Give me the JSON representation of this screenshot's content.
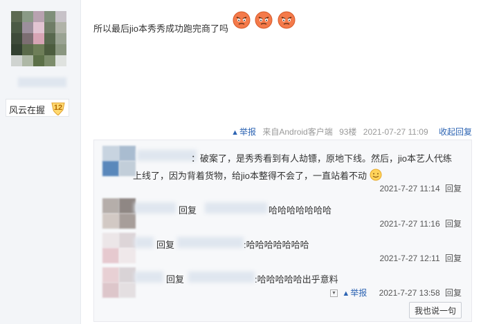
{
  "user": {
    "badge_name": "风云在握",
    "badge_level": "12"
  },
  "post": {
    "text": "所以最后jio本秀秀成功跑完商了吗",
    "emojis": [
      "angry-face-icon",
      "angry-face-icon",
      "angry-face-icon"
    ]
  },
  "tail": {
    "report_label": "举报",
    "source": "来自Android客户端",
    "floor": "93楼",
    "time": "2021-07-27 11:09",
    "fold_label": "收起回复"
  },
  "replies": [
    {
      "line1": "：破案了，是秀秀看到有人劫镖，原地下线。然后，jio本艺人代练",
      "line2": "上线了，因为背着货物，给jio本整得不会了，一直站着不动",
      "time": "2021-7-27 11:14",
      "reply_label": "回复"
    },
    {
      "prefix": "回复",
      "text": "哈哈哈哈哈哈哈",
      "time": "2021-7-27 11:16",
      "reply_label": "回复"
    },
    {
      "prefix": "回复",
      "text": ":哈哈哈哈哈哈哈",
      "time": "2021-7-27 12:11",
      "reply_label": "回复"
    },
    {
      "prefix": "回复",
      "text": ":哈哈哈哈哈出乎意料",
      "report_label": "举报",
      "time": "2021-7-27 13:58",
      "reply_label": "回复"
    }
  ],
  "say_button": "我也说一句",
  "colors": {
    "link": "#2d64b3",
    "sidebar_bg": "#f3f5f8",
    "reply_bg": "#f7f8fa"
  }
}
